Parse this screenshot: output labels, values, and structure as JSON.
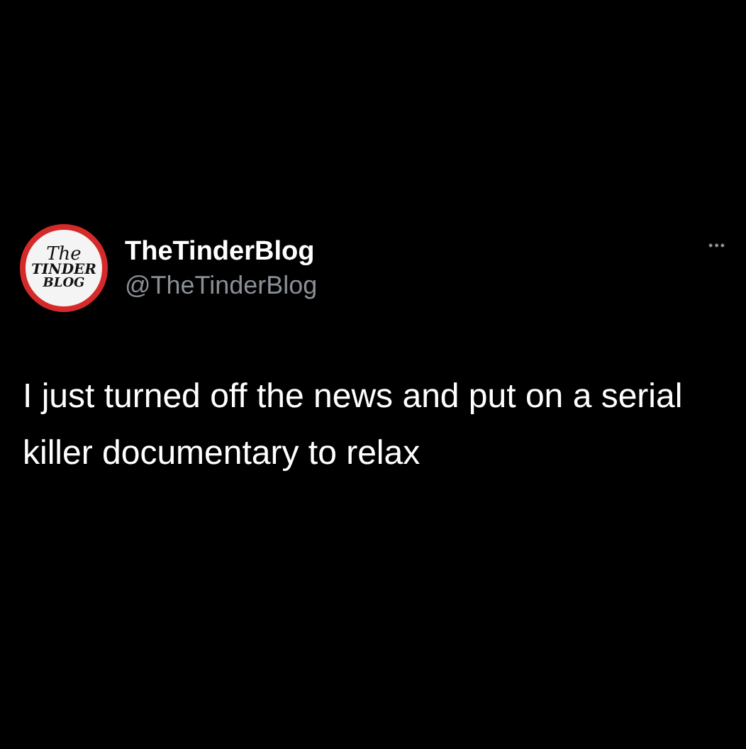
{
  "author": {
    "avatar_lines": [
      "The",
      "TINDER",
      "BLOG"
    ],
    "name": "TheTinderBlog",
    "handle": "@TheTinderBlog"
  },
  "more_menu": "•••",
  "tweet_text": "I just turned off the news and put on a serial killer documentary to relax"
}
